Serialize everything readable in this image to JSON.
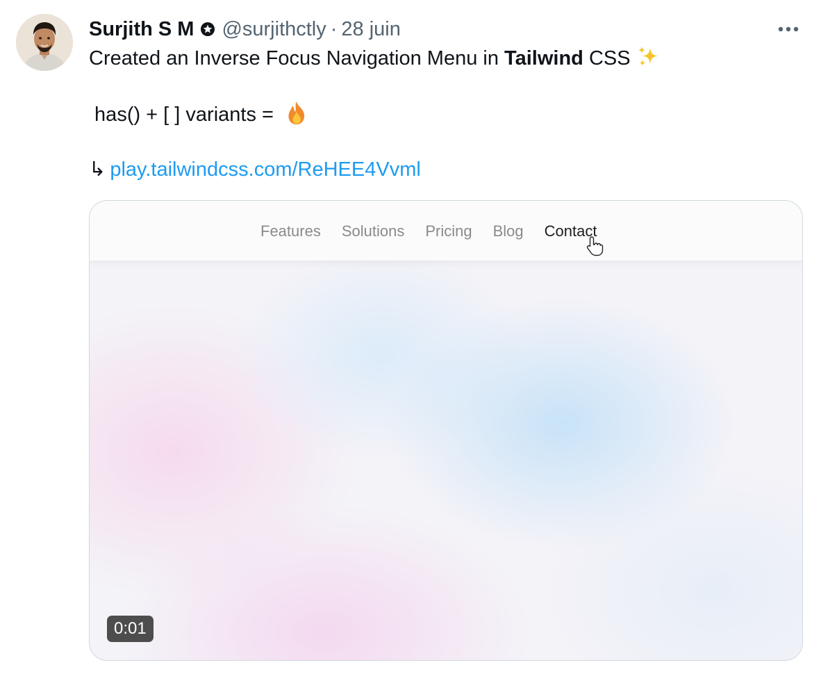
{
  "author": {
    "name": "Surjith S M",
    "handle": "@surjithctly",
    "separator": "·",
    "date": "28 juin",
    "badge_icon": "verified-badge-icon"
  },
  "more_icon": "more-options-icon",
  "tweet": {
    "line1_prefix": "Created an Inverse Focus Navigation Menu in ",
    "line1_bold": "Tailwind",
    "line1_suffix": " CSS",
    "line1_emoji": "sparkles-emoji",
    "line2_text": " has() + [ ] variants = ",
    "line2_emoji": "fire-emoji",
    "line3_arrow": "↳",
    "link": "play.tailwindcss.com/ReHEE4Vvml"
  },
  "media": {
    "nav_items": [
      "Features",
      "Solutions",
      "Pricing",
      "Blog",
      "Contact"
    ],
    "active_item": "Contact",
    "cursor_icon": "hand-pointer-icon",
    "timestamp": "0:01"
  },
  "colors": {
    "text": "#0f1419",
    "secondary": "#536471",
    "link": "#1d9bf0",
    "border": "#cfd9de"
  }
}
